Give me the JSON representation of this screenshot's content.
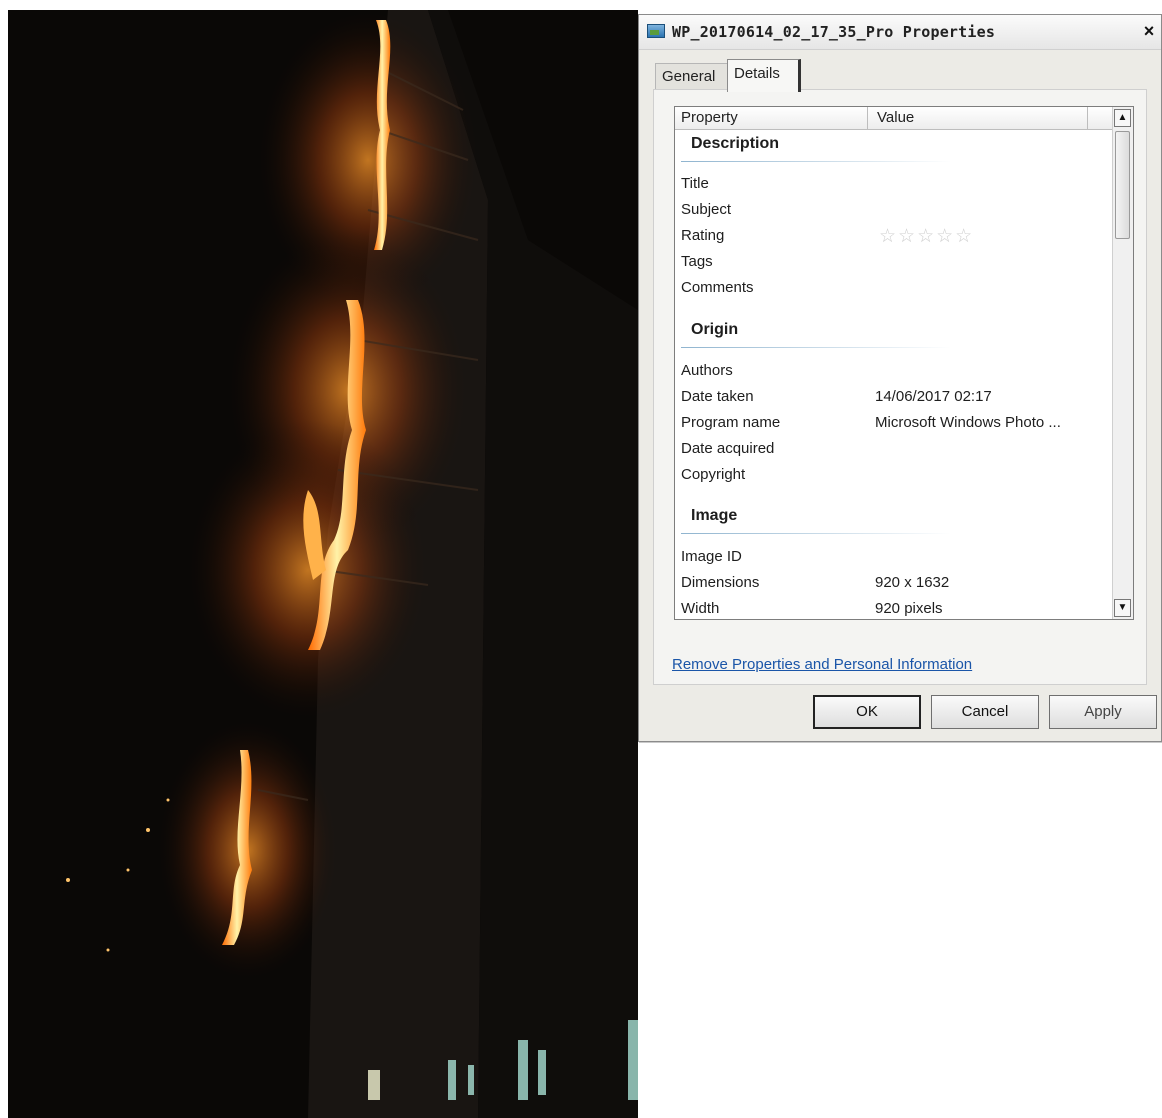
{
  "photo": {
    "description_icon": "night-building-fire-photo"
  },
  "dialog": {
    "title": "WP_20170614_02_17_35_Pro Properties",
    "close_label": "×",
    "tabs": [
      {
        "label": "General",
        "active": false
      },
      {
        "label": "Details",
        "active": true
      }
    ],
    "columns": {
      "property": "Property",
      "value": "Value"
    },
    "groups": {
      "description": "Description",
      "origin": "Origin",
      "image": "Image"
    },
    "description_rows": [
      {
        "property": "Title",
        "value": ""
      },
      {
        "property": "Subject",
        "value": ""
      },
      {
        "property": "Rating",
        "value": "☆☆☆☆☆"
      },
      {
        "property": "Tags",
        "value": ""
      },
      {
        "property": "Comments",
        "value": ""
      }
    ],
    "origin_rows": [
      {
        "property": "Authors",
        "value": ""
      },
      {
        "property": "Date taken",
        "value": "14/06/2017 02:17"
      },
      {
        "property": "Program name",
        "value": "Microsoft Windows Photo ..."
      },
      {
        "property": "Date acquired",
        "value": ""
      },
      {
        "property": "Copyright",
        "value": ""
      }
    ],
    "image_rows": [
      {
        "property": "Image ID",
        "value": ""
      },
      {
        "property": "Dimensions",
        "value": "920 x 1632"
      },
      {
        "property": "Width",
        "value": "920 pixels"
      }
    ],
    "scroll_up": "▲",
    "scroll_down": "▼",
    "remove_link": "Remove Properties and Personal Information",
    "buttons": {
      "ok": "OK",
      "cancel": "Cancel",
      "apply": "Apply"
    }
  },
  "colors": {
    "dialog_bg": "#ecebe6",
    "link": "#1a55a8",
    "fire": "#ff8a1e",
    "night": "#0a0806"
  }
}
